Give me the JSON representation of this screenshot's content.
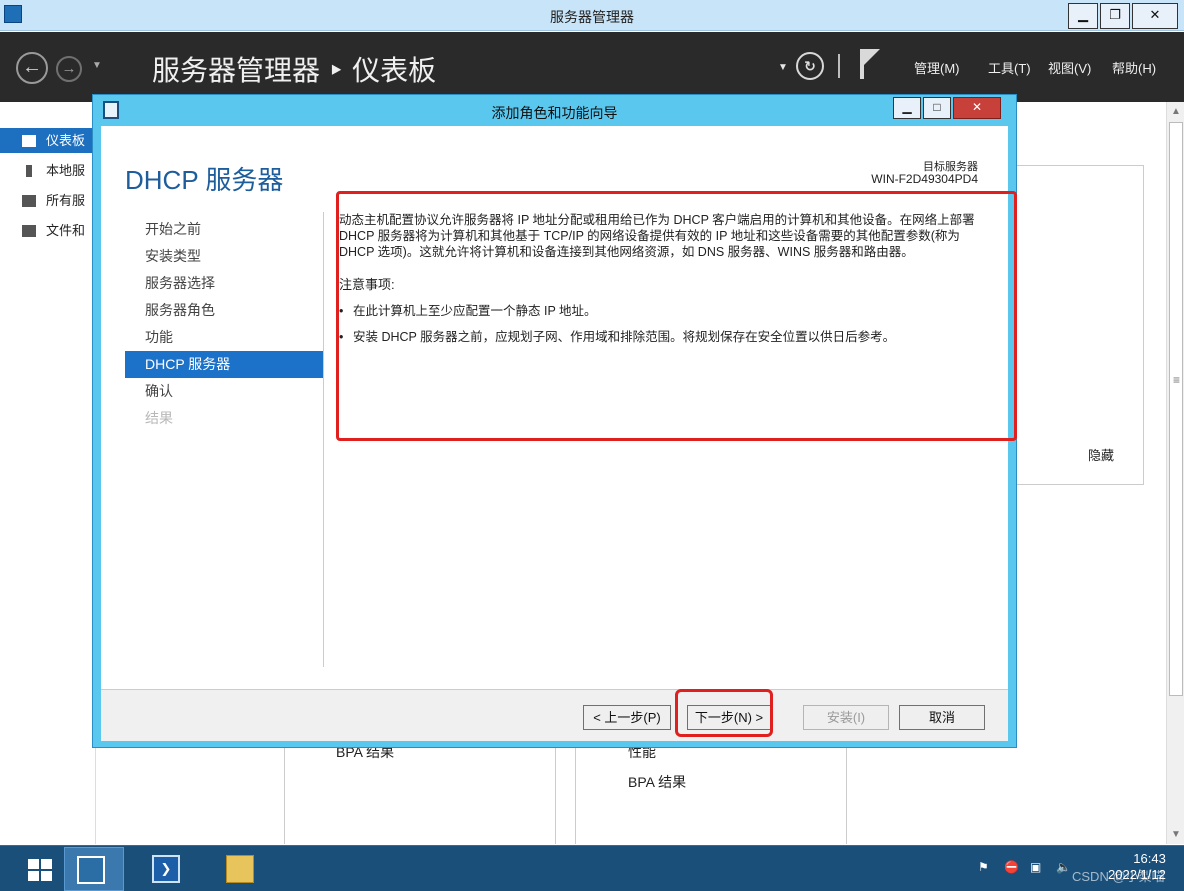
{
  "window": {
    "title": "服务器管理器"
  },
  "header": {
    "breadcrumb": "服务器管理器 ‣ 仪表板",
    "menus": [
      "管理(M)",
      "工具(T)",
      "视图(V)",
      "帮助(H)"
    ]
  },
  "left_nav": {
    "items": [
      {
        "label": "仪表板",
        "active": true
      },
      {
        "label": "本地服",
        "active": false
      },
      {
        "label": "所有服",
        "active": false
      },
      {
        "label": "文件和",
        "active": false
      }
    ]
  },
  "background": {
    "hide_label": "隐藏",
    "tile_text_1": "BPA 结果",
    "tile_text_2": "性能",
    "tile_text_3": "BPA 结果"
  },
  "wizard": {
    "title": "添加角色和功能向导",
    "page_heading": "DHCP 服务器",
    "target_label": "目标服务器",
    "target_value": "WIN-F2D49304PD4",
    "steps": [
      {
        "label": "开始之前",
        "state": "normal"
      },
      {
        "label": "安装类型",
        "state": "normal"
      },
      {
        "label": "服务器选择",
        "state": "normal"
      },
      {
        "label": "服务器角色",
        "state": "normal"
      },
      {
        "label": "功能",
        "state": "normal"
      },
      {
        "label": "DHCP 服务器",
        "state": "active"
      },
      {
        "label": "确认",
        "state": "normal"
      },
      {
        "label": "结果",
        "state": "disabled"
      }
    ],
    "description": "动态主机配置协议允许服务器将 IP 地址分配或租用给已作为 DHCP 客户端启用的计算机和其他设备。在网络上部署 DHCP 服务器将为计算机和其他基于 TCP/IP 的网络设备提供有效的 IP 地址和这些设备需要的其他配置参数(称为 DHCP 选项)。这就允许将计算机和设备连接到其他网络资源，如 DNS 服务器、WINS 服务器和路由器。",
    "note_title": "注意事项:",
    "notes": [
      "在此计算机上至少应配置一个静态 IP 地址。",
      "安装 DHCP 服务器之前，应规划子网、作用域和排除范围。将规划保存在安全位置以供日后参考。"
    ],
    "buttons": {
      "prev": "< 上一步(P)",
      "next": "下一步(N) >",
      "install": "安装(I)",
      "cancel": "取消"
    }
  },
  "taskbar": {
    "time": "16:43",
    "date": "2022/1/12",
    "watermark": "CSDN @小梨喵"
  },
  "colors": {
    "accent": "#1c72c8",
    "wizard_frame": "#5ac8ee",
    "highlight_box": "#e0201e",
    "header_bg": "#2a2a2a",
    "taskbar_bg": "#1a4f7a"
  }
}
